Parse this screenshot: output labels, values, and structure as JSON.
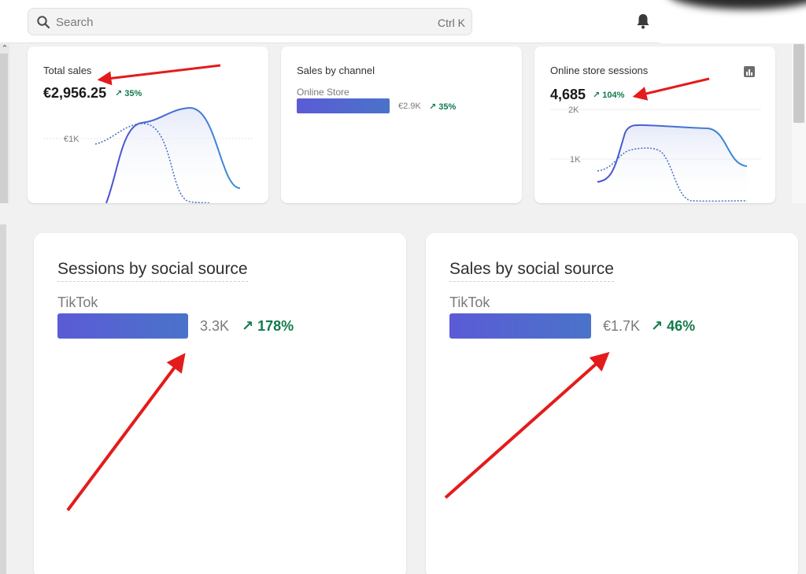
{
  "search": {
    "placeholder": "Search",
    "shortcut": "Ctrl K"
  },
  "icons": {
    "search": "search-icon",
    "bell": "bell-icon",
    "chart": "bar-chart-icon",
    "arrow_up": "arrow-up-right-icon"
  },
  "colors": {
    "accent_green": "#137a4b",
    "bar_start": "#5b5bd6",
    "bar_end": "#4a73c9",
    "annotation_red": "#e41b1b"
  },
  "cards": {
    "total_sales": {
      "title": "Total sales",
      "value": "€2,956.25",
      "delta": "35%",
      "axis_label": "€1K"
    },
    "sales_by_channel": {
      "title": "Sales by channel",
      "channel": "Online Store",
      "value": "€2.9K",
      "delta": "35%",
      "bar_fraction": 1.0
    },
    "online_store_sessions": {
      "title": "Online store sessions",
      "value": "4,685",
      "delta": "104%",
      "axis_top": "2K",
      "axis_mid": "1K"
    },
    "sessions_by_social": {
      "title": "Sessions by social source",
      "source": "TikTok",
      "value": "3.3K",
      "delta": "178%",
      "bar_fraction": 1.0
    },
    "sales_by_social": {
      "title": "Sales by social source",
      "source": "TikTok",
      "value": "€1.7K",
      "delta": "46%",
      "bar_fraction": 1.0
    }
  }
}
